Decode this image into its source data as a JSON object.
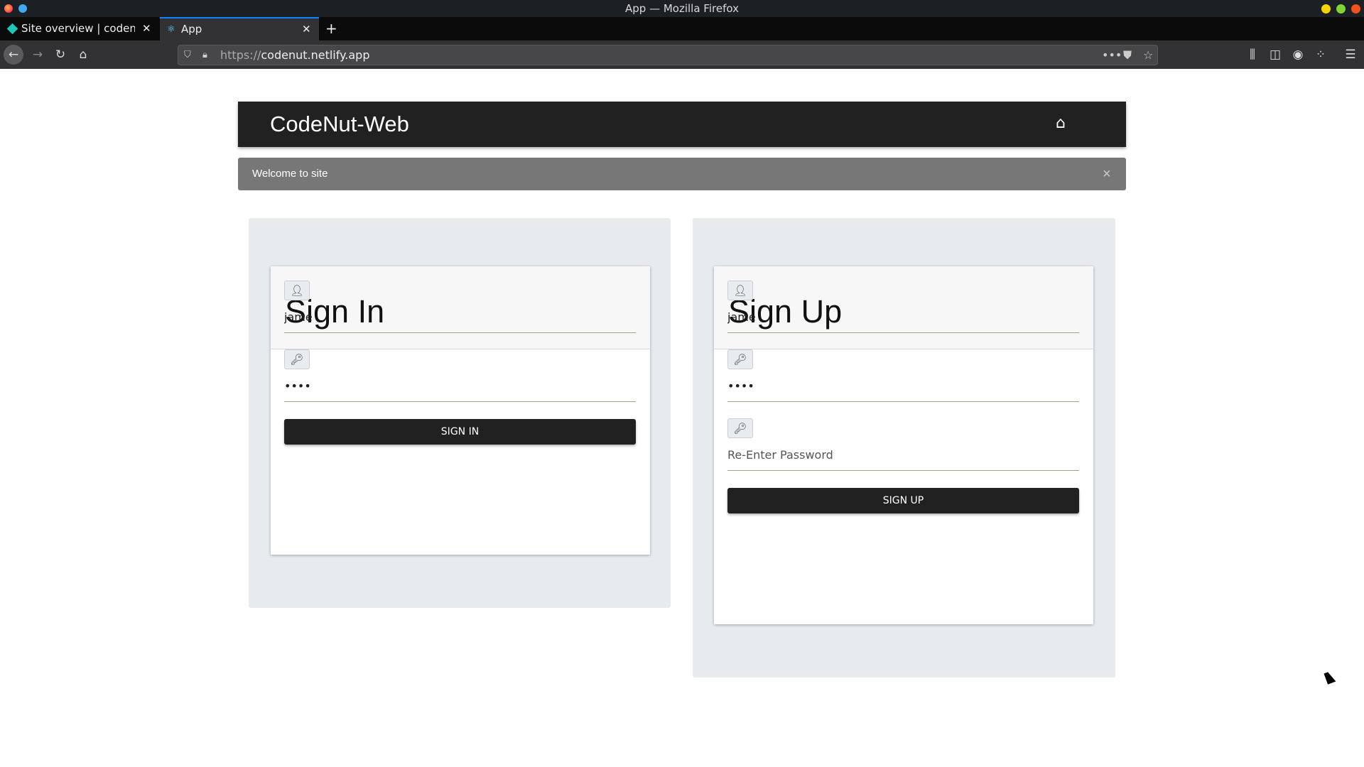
{
  "browser": {
    "window_title": "App — Mozilla Firefox",
    "tabs": [
      {
        "label": "Site overview | codenut",
        "icon": "netlify-diamond-icon"
      },
      {
        "label": "App",
        "icon": "react-icon",
        "active": true
      }
    ],
    "url_scheme": "https://",
    "url_host": "codenut.netlify.app",
    "accent": "#0a84ff"
  },
  "app": {
    "brand": "CodeNut-Web",
    "alert": "Welcome to site",
    "alert_close": "×"
  },
  "signin": {
    "title": "Sign In",
    "username": "jame",
    "password": "••••",
    "button": "SIGN IN"
  },
  "signup": {
    "title": "Sign Up",
    "username": "jame",
    "password": "••••",
    "reenter_placeholder": "Re-Enter Password",
    "button": "SIGN UP"
  }
}
